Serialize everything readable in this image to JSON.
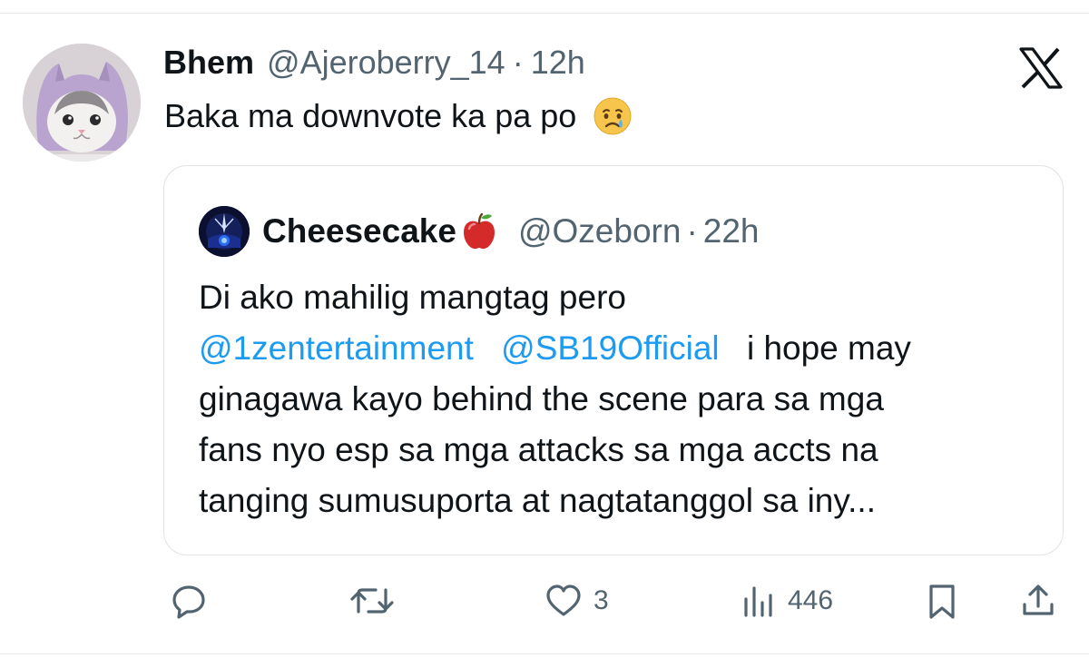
{
  "tweet": {
    "author_name": "Bhem",
    "handle": "@Ajeroberry_14",
    "separator": "·",
    "time": "12h",
    "text": "Baka ma downvote ka pa po",
    "emoji_icon": "crying-face-icon"
  },
  "quoted": {
    "author_name": "Cheesecake",
    "name_emoji_icon": "red-apple-icon",
    "handle": "@Ozeborn",
    "separator": "·",
    "time": "22h",
    "line1": "Di ako mahilig mangtag pero",
    "mention1": "@1zentertainment",
    "mention2": "@SB19Official",
    "line2_rest": "i hope may",
    "line3": "ginagawa kayo behind the scene para sa mga",
    "line4": "fans nyo esp sa mga attacks sa mga accts na",
    "line5": "tanging sumusuporta at nagtatanggol sa iny..."
  },
  "actions": {
    "reply_icon": "reply-icon",
    "retweet_icon": "retweet-icon",
    "like_icon": "heart-icon",
    "like_count": "3",
    "views_icon": "views-chart-icon",
    "views_count": "446",
    "bookmark_icon": "bookmark-icon",
    "share_icon": "share-icon"
  },
  "colors": {
    "text": "#0f1419",
    "secondary": "#536471",
    "link": "#1d9bf0",
    "border": "#dfe3e6"
  }
}
